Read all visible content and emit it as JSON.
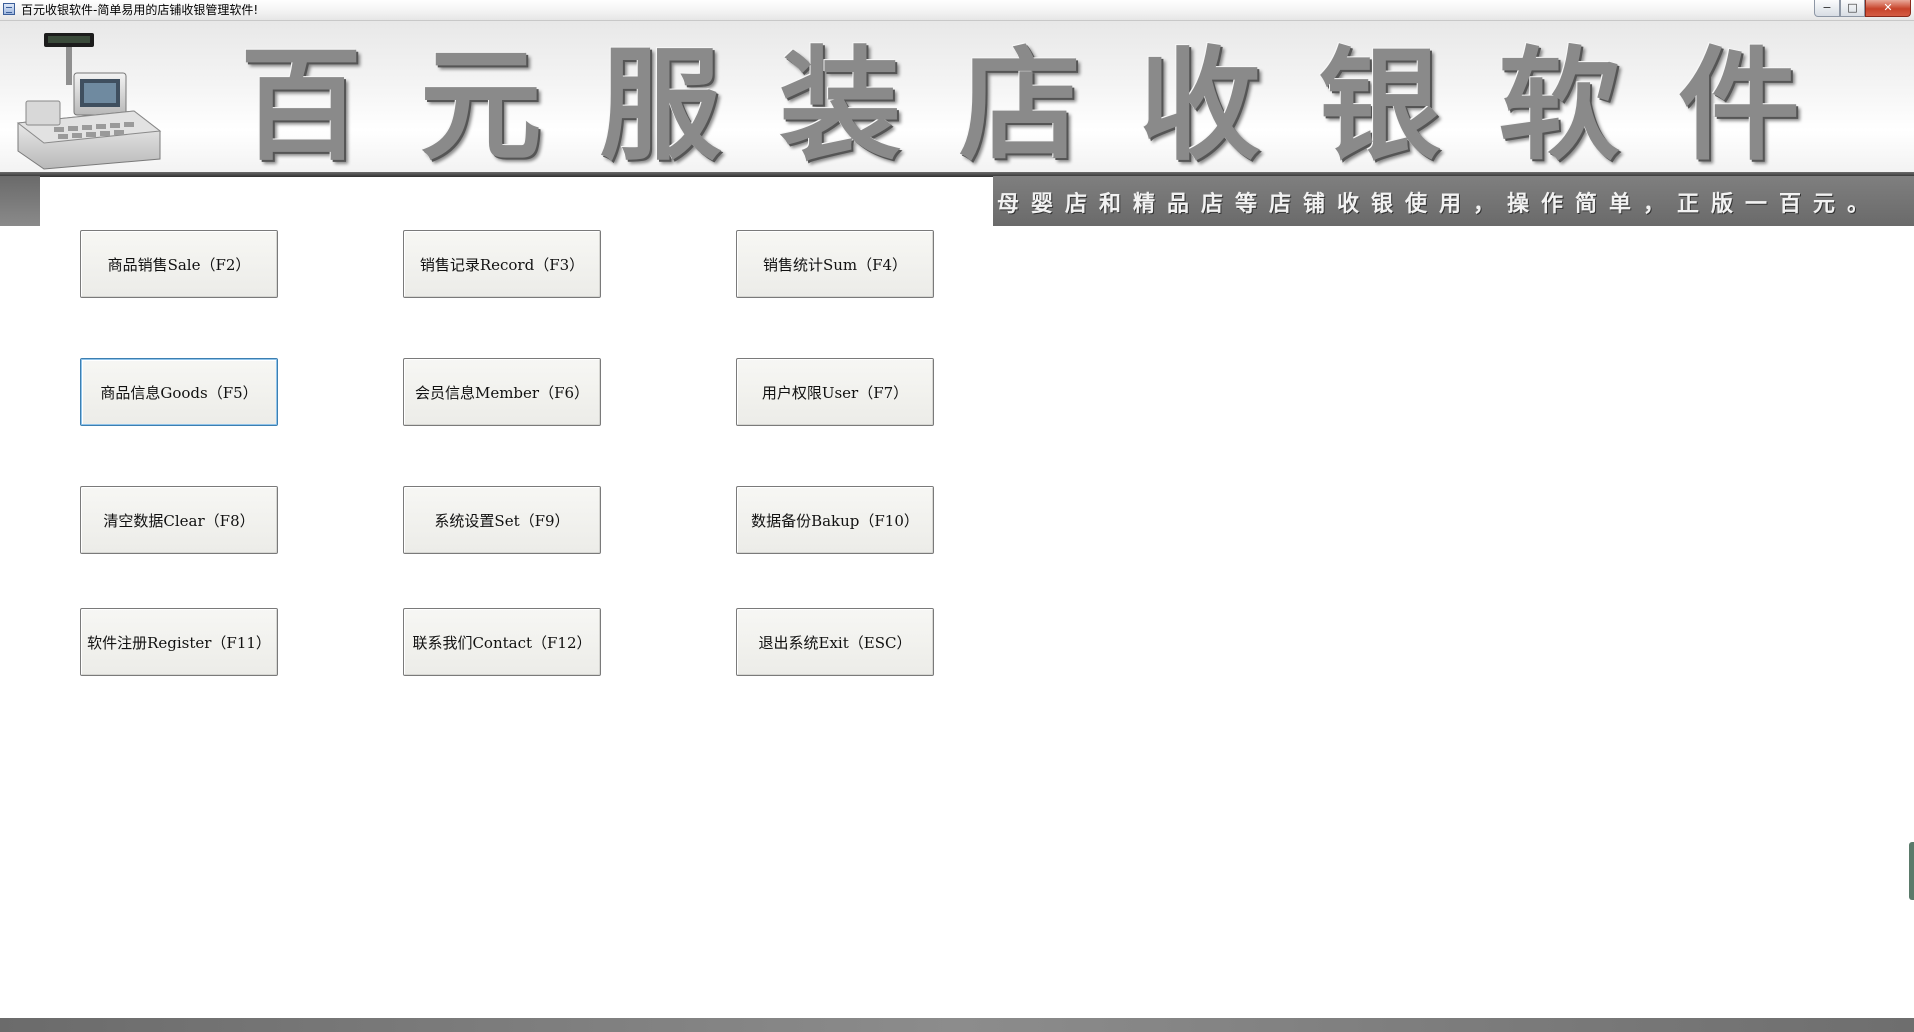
{
  "window": {
    "title": "百元收银软件-简单易用的店铺收银管理软件!",
    "minimize_glyph": "−",
    "maximize_glyph": "□",
    "close_glyph": "✕"
  },
  "banner": {
    "title_chars": [
      "百",
      "元",
      "服",
      "装",
      "店",
      "收",
      "银",
      "软",
      "件"
    ],
    "slogan": "母婴店和精品店等店铺收银使用，操作简单，正版一百元。",
    "icon": "cash-register-icon"
  },
  "menu": {
    "sale": "商品销售Sale（F2）",
    "record": "销售记录Record（F3）",
    "sum": "销售统计Sum（F4）",
    "goods": "商品信息Goods（F5）",
    "member": "会员信息Member（F6）",
    "user": "用户权限User（F7）",
    "clear": "清空数据Clear（F8）",
    "set": "系统设置Set（F9）",
    "bakup": "数据备份Bakup（F10）",
    "register": "软件注册Register（F11）",
    "contact": "联系我们Contact（F12）",
    "exit": "退出系统Exit（ESC）"
  }
}
